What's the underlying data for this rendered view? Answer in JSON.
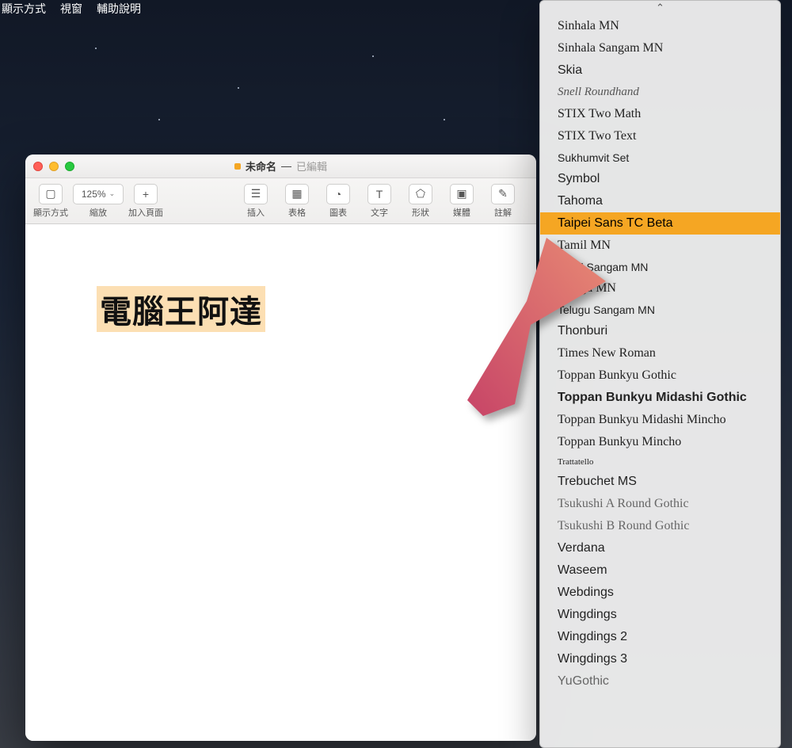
{
  "menubar": {
    "items": [
      "顯示方式",
      "視窗",
      "輔助說明"
    ]
  },
  "window": {
    "title": "未命名",
    "edited": "已編輯",
    "toolbar": {
      "view_label": "顯示方式",
      "zoom_value": "125%",
      "zoom_label": "縮放",
      "addpage_label": "加入頁面",
      "insert_label": "插入",
      "table_label": "表格",
      "chart_label": "圖表",
      "text_label": "文字",
      "shape_label": "形狀",
      "media_label": "媒體",
      "comment_label": "註解"
    },
    "canvas_text": "電腦王阿達"
  },
  "font_panel": {
    "items": [
      {
        "label": "Sinhala MN",
        "style": "serif"
      },
      {
        "label": "Sinhala Sangam MN",
        "style": "serif"
      },
      {
        "label": "Skia",
        "style": ""
      },
      {
        "label": "Snell Roundhand",
        "style": "script"
      },
      {
        "label": "STIX Two Math",
        "style": "serif"
      },
      {
        "label": "STIX Two Text",
        "style": "serif"
      },
      {
        "label": "Sukhumvit Set",
        "style": "small"
      },
      {
        "label": "Symbol",
        "style": ""
      },
      {
        "label": "Tahoma",
        "style": ""
      },
      {
        "label": "Taipei Sans TC Beta",
        "style": "",
        "selected": true
      },
      {
        "label": "Tamil MN",
        "style": "serif"
      },
      {
        "label": "Tamil Sangam MN",
        "style": "small"
      },
      {
        "label": "Telugu MN",
        "style": "serif"
      },
      {
        "label": "Telugu Sangam MN",
        "style": "small"
      },
      {
        "label": "Thonburi",
        "style": ""
      },
      {
        "label": "Times New Roman",
        "style": "serif"
      },
      {
        "label": "Toppan Bunkyu Gothic",
        "style": "serif"
      },
      {
        "label": "Toppan Bunkyu Midashi Gothic",
        "style": "bold"
      },
      {
        "label": "Toppan Bunkyu Midashi Mincho",
        "style": "serif"
      },
      {
        "label": "Toppan Bunkyu Mincho",
        "style": "serif"
      },
      {
        "label": "Trattatello",
        "style": "tiny"
      },
      {
        "label": "Trebuchet MS",
        "style": ""
      },
      {
        "label": "Tsukushi A Round Gothic",
        "style": "muted serif"
      },
      {
        "label": "Tsukushi B Round Gothic",
        "style": "muted serif"
      },
      {
        "label": "Verdana",
        "style": ""
      },
      {
        "label": "Waseem",
        "style": ""
      },
      {
        "label": "Webdings",
        "style": ""
      },
      {
        "label": "Wingdings",
        "style": ""
      },
      {
        "label": "Wingdings 2",
        "style": ""
      },
      {
        "label": "Wingdings 3",
        "style": ""
      },
      {
        "label": "YuGothic",
        "style": "muted"
      }
    ]
  },
  "icons": {
    "view": "▢",
    "addpage": "⊕",
    "insert": "≡",
    "table": "▦",
    "chart": "◔",
    "text": "T",
    "shape": "⬠",
    "media": "▣",
    "comment": "✎"
  },
  "colors": {
    "highlight": "#fcdfb3",
    "selection": "#f5a623",
    "arrow_start": "#c74467",
    "arrow_end": "#e88a74"
  }
}
